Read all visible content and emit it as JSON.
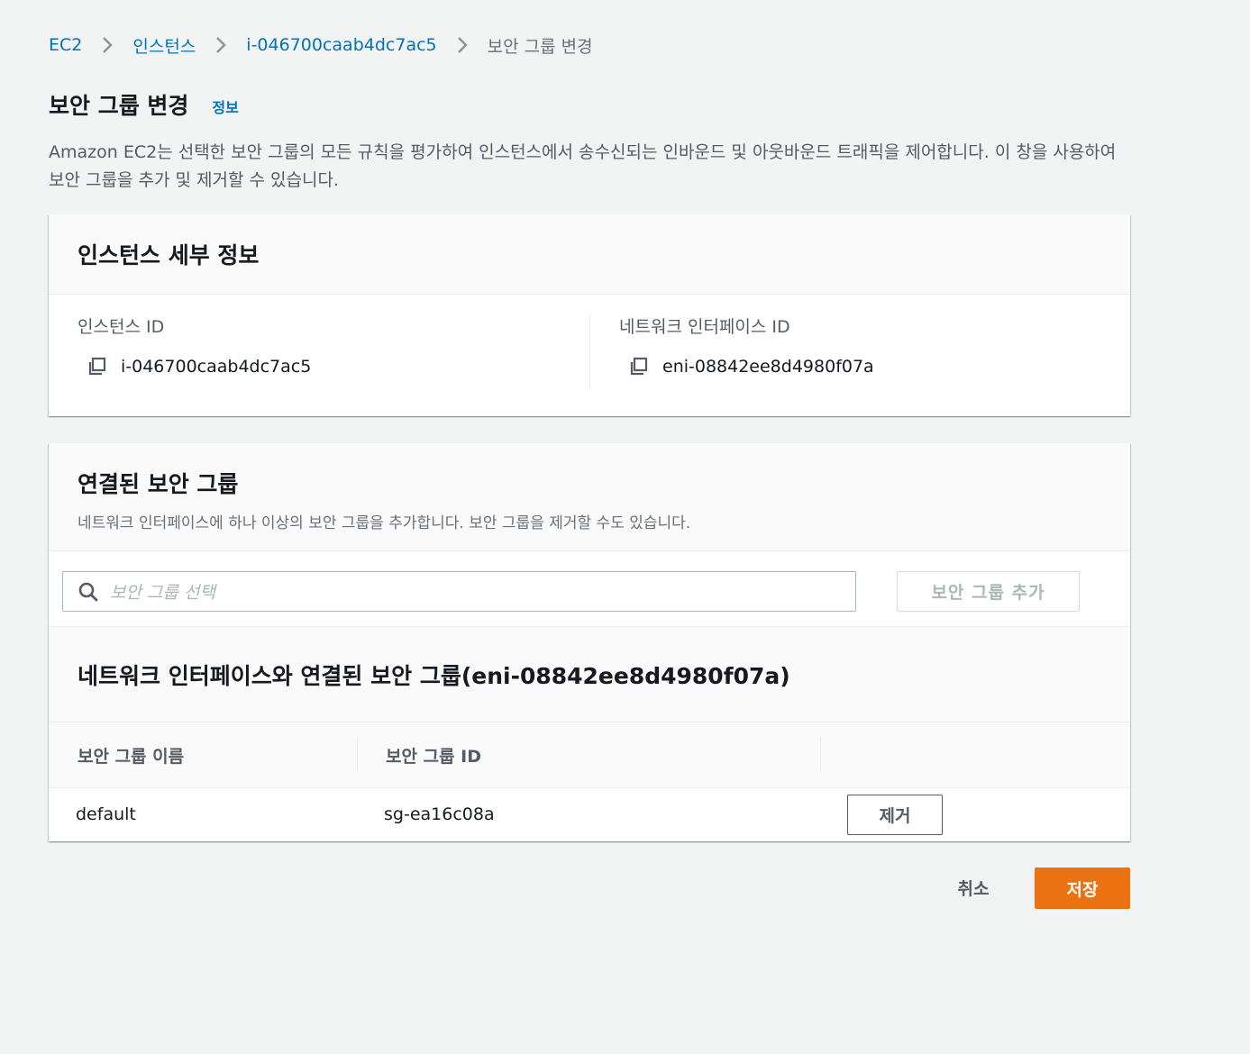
{
  "breadcrumb": {
    "items": [
      "EC2",
      "인스턴스",
      "i-046700caab4dc7ac5"
    ],
    "current": "보안 그룹 변경"
  },
  "header": {
    "title": "보안 그룹 변경",
    "info_link": "정보",
    "description": "Amazon EC2는 선택한 보안 그룹의 모든 규칙을 평가하여 인스턴스에서 송수신되는 인바운드 및 아웃바운드 트래픽을 제어합니다. 이 창을 사용하여 보안 그룹을 추가 및 제거할 수 있습니다."
  },
  "instance_details": {
    "title": "인스턴스 세부 정보",
    "instance_id_label": "인스턴스 ID",
    "instance_id": "i-046700caab4dc7ac5",
    "eni_label": "네트워크 인터페이스 ID",
    "eni_id": "eni-08842ee8d4980f07a"
  },
  "security_groups": {
    "title": "연결된 보안 그룹",
    "subtitle": "네트워크 인터페이스에 하나 이상의 보안 그룹을 추가합니다. 보안 그룹을 제거할 수도 있습니다.",
    "search_placeholder": "보안 그룹 선택",
    "add_button": "보안 그룹 추가",
    "table_title": "네트워크 인터페이스와 연결된 보안 그룹(eni-08842ee8d4980f07a)",
    "columns": [
      "보안 그룹 이름",
      "보안 그룹 ID"
    ],
    "rows": [
      {
        "name": "default",
        "id": "sg-ea16c08a",
        "action": "제거"
      }
    ]
  },
  "footer": {
    "cancel": "취소",
    "save": "저장"
  },
  "colors": {
    "link": "#0073bb",
    "primary_button": "#ec7211",
    "background": "#f2f3f3"
  },
  "icons": [
    "chevron-right-icon",
    "copy-icon",
    "search-icon"
  ]
}
